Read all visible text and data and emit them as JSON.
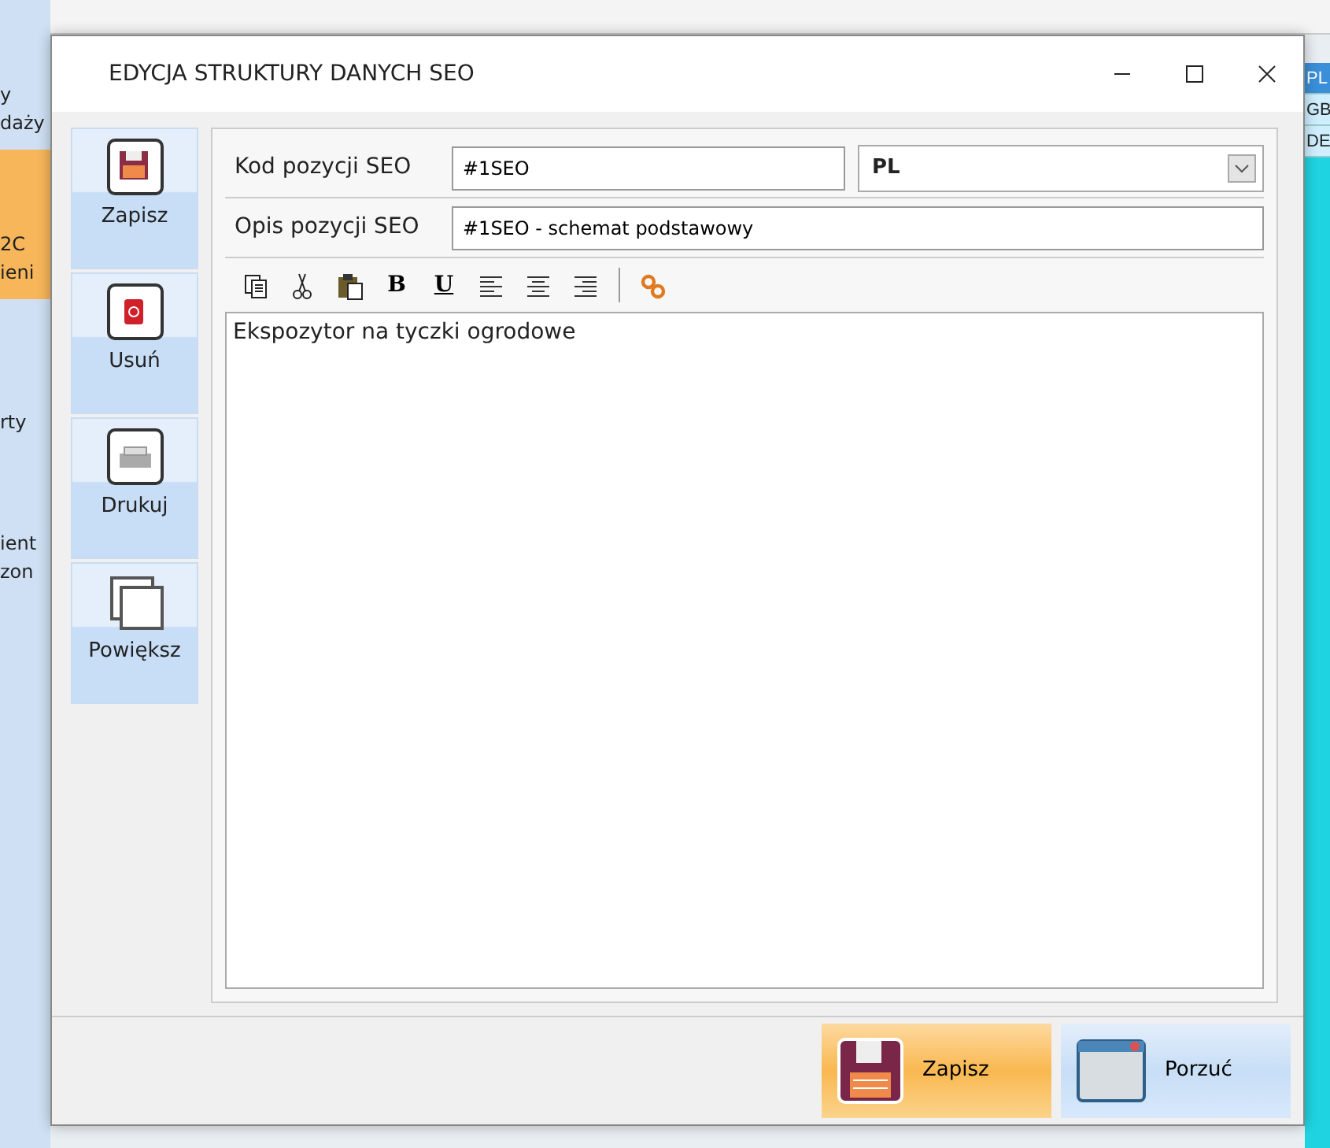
{
  "background_app": {
    "left_tiles": [
      {
        "lines": [
          "y",
          "daży"
        ],
        "selected": false
      },
      {
        "lines": [
          "2C",
          "ieni"
        ],
        "selected": true
      },
      {
        "lines": [
          "rty"
        ],
        "selected": false
      },
      {
        "lines": [
          "ient",
          "zon"
        ],
        "selected": false
      }
    ],
    "right_labels": [
      "PL",
      "GB",
      "DE"
    ]
  },
  "window": {
    "title": "EDYCJA STRUKTURY DANYCH SEO"
  },
  "side_buttons": [
    {
      "label": "Zapisz",
      "kind": "save"
    },
    {
      "label": "Usuń",
      "kind": "delete"
    },
    {
      "label": "Drukuj",
      "kind": "print"
    },
    {
      "label": "Powiększ",
      "kind": "maximize"
    }
  ],
  "fields": {
    "code_label": "Kod pozycji SEO",
    "code_value": "#1SEO",
    "language": "PL",
    "description_label": "Opis pozycji SEO",
    "description_value": "#1SEO - schemat podstawowy"
  },
  "editor": {
    "toolbar": [
      {
        "kind": "copy"
      },
      {
        "kind": "cut"
      },
      {
        "kind": "paste"
      },
      {
        "kind": "bold",
        "glyph": "B"
      },
      {
        "kind": "underline",
        "glyph": "U"
      },
      {
        "kind": "align-left"
      },
      {
        "kind": "align-center"
      },
      {
        "kind": "align-right"
      },
      {
        "kind": "separator"
      },
      {
        "kind": "link"
      }
    ],
    "text": "Ekspozytor na tyczki ogrodowe"
  },
  "footer_buttons": [
    {
      "label": "Zapisz",
      "kind": "save"
    },
    {
      "label": "Porzuć",
      "kind": "discard"
    }
  ]
}
